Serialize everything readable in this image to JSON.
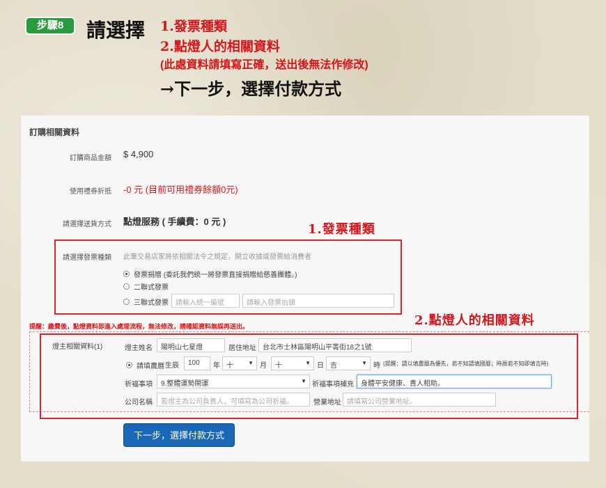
{
  "header": {
    "badge": "步驟8",
    "title": "請選擇",
    "item1": "1.發票種類",
    "item2": "2.點燈人的相關資料",
    "note": "(此處資料請填寫正確，送出後無法作修改)",
    "next": "→下一步，選擇付款方式"
  },
  "order": {
    "section_title": "訂購相關資料",
    "amount_label": "訂購商品金額",
    "amount_value": "$ 4,900",
    "coupon_label": "使用禮券折抵",
    "coupon_value": "-0 元 (目前可用禮券餘額0元)",
    "ship_label": "請選擇送貨方式",
    "ship_value": "點燈服務 ( 手續費：0 元 )"
  },
  "invoice": {
    "callout": "1.發票種類",
    "label": "請選擇發票種類",
    "hint": "此筆交易店家將依相關法令之規定，開立收據或發票給消費者",
    "option_donate": "發票捐贈 (委託我們統一將發票直接捐贈給慈善團體。)",
    "option_two": "二聯式發票",
    "option_three": "三聯式發票",
    "tax_id_placeholder": "請輸入統一編號",
    "title_placeholder": "請輸入發票抬頭"
  },
  "lamp": {
    "callout": "2.點燈人的相關資料",
    "warning": "提醒：繳費後，點燈資料即進入處理流程，無法修改，請確認資料無誤再送出。",
    "person_label": "燈主相關資料(1)",
    "name_label": "燈主姓名",
    "name_value": "陽明山七星燈",
    "addr_label": "居住地址",
    "addr_value": "台北市士林區陽明山平菁街18之1號",
    "lunar_label": "請填農曆",
    "birth_label": "生辰",
    "year_value": "100",
    "year_unit": "年",
    "month_value": "十",
    "month_unit": "月",
    "day_value": "十",
    "day_unit": "日",
    "hour_value": "吉",
    "hour_unit": "時",
    "birth_note": "(提醒：請以填農曆為優先，若不知請填國曆；時辰若不知即填吉時)",
    "pray_label": "祈福事項",
    "pray_value": "9.整體運勢開運",
    "pray_extra_label": "祈福事項補充",
    "pray_extra_value": "身體平安健康、貴人相助。",
    "company_label": "公司名稱",
    "company_placeholder": "若燈主為公司負責人，可填寫為公司祈福。",
    "company_addr_label": "營業地址",
    "company_addr_placeholder": "請填寫公司營業地址。"
  },
  "actions": {
    "next_button": "下一步，選擇付款方式"
  },
  "colors": {
    "badge_green": "#2b9a3e",
    "accent_red": "#d4161c",
    "button_blue": "#1a67b8"
  }
}
